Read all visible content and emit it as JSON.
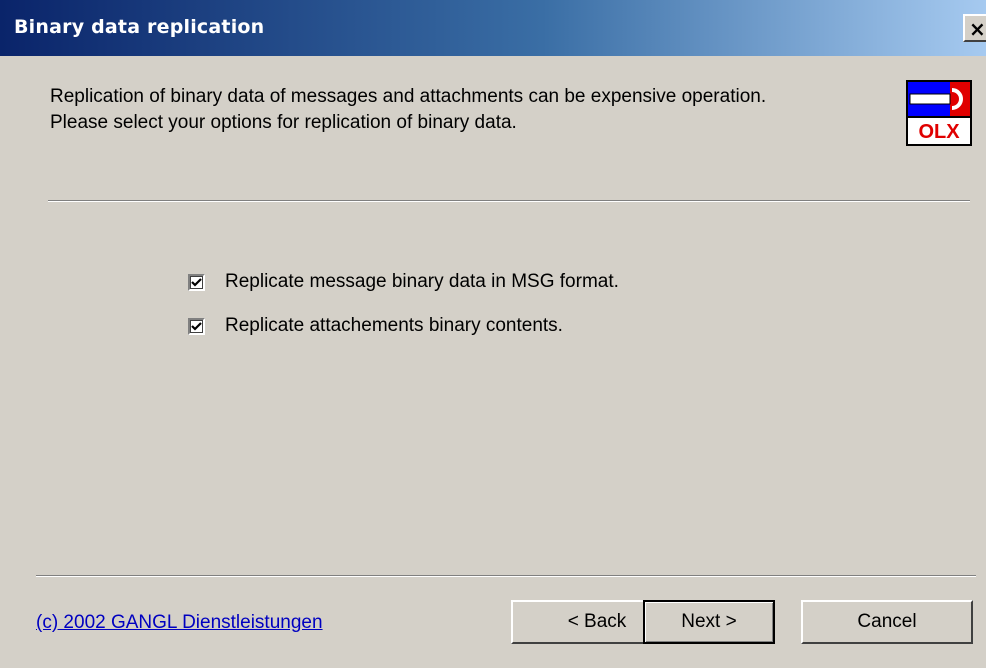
{
  "window": {
    "title": "Binary data replication",
    "close_glyph": "✕"
  },
  "header": {
    "description_line1": "Replication of binary data of messages and attachments can be expensive operation.",
    "description_line2": "Please select your options for replication of binary data.",
    "logo_icon": "olx-logo-icon",
    "logo_text": "OLX"
  },
  "options": [
    {
      "label": "Replicate message binary data in MSG format.",
      "checked": true
    },
    {
      "label": "Replicate attachements binary contents.",
      "checked": true
    }
  ],
  "footer": {
    "copyright_link": "(c) 2002 GANGL Dienstleistungen",
    "back_label": "< Back",
    "next_label": "Next >",
    "cancel_label": "Cancel"
  },
  "colors": {
    "title_gradient_start": "#0a246a",
    "title_gradient_end": "#a6caf0",
    "dialog_bg": "#d4d0c8",
    "link": "#0000c0",
    "logo_red": "#e00000",
    "logo_blue": "#0000ff"
  }
}
